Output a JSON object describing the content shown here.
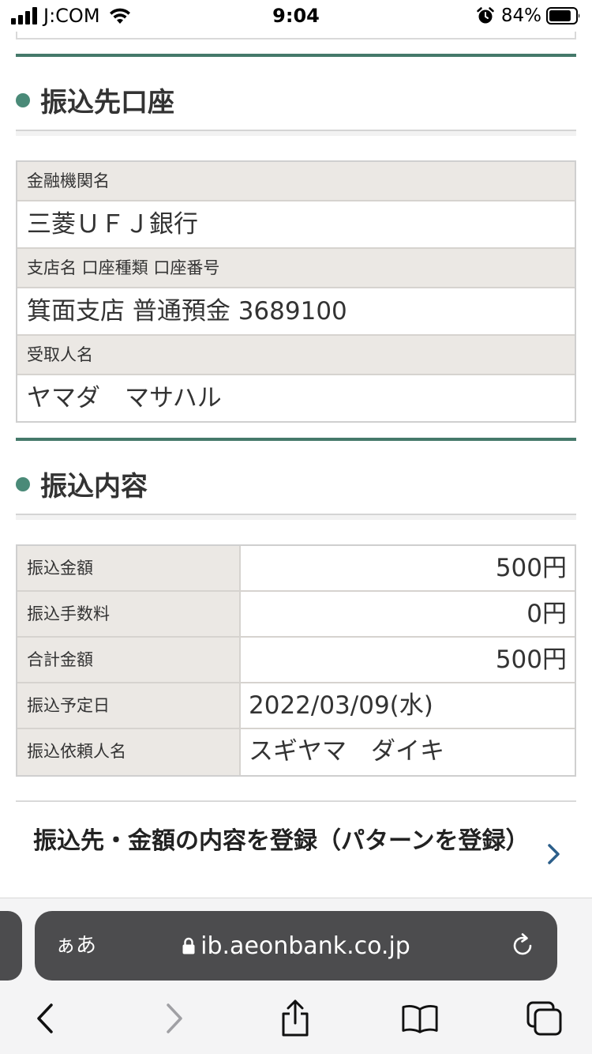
{
  "status_bar": {
    "carrier": "J:COM",
    "time": "9:04",
    "battery_percent": "84%",
    "battery_level": 0.84,
    "icons": [
      "signal-icon",
      "wifi-icon",
      "alarm-icon",
      "battery-icon"
    ]
  },
  "payee_section": {
    "title": "振込先口座",
    "rows": [
      {
        "label": "金融機関名",
        "value": "三菱ＵＦＪ銀行"
      },
      {
        "label": "支店名 口座種類 口座番号",
        "value": "箕面支店 普通預金 3689100"
      },
      {
        "label": "受取人名",
        "value": "ヤマダ　マサハル"
      }
    ]
  },
  "transfer_section": {
    "title": "振込内容",
    "rows": [
      {
        "label": "振込金額",
        "value": "500円"
      },
      {
        "label": "振込手数料",
        "value": "0円"
      },
      {
        "label": "合計金額",
        "value": "500円"
      },
      {
        "label": "振込予定日",
        "value": "2022/03/09(水)"
      },
      {
        "label": "振込依頼人名",
        "value": "スギヤマ　ダイキ"
      }
    ]
  },
  "register_link": {
    "label": "振込先・金額の内容を登録（パターンを登録）",
    "icon": "chevron-right-icon"
  },
  "browser": {
    "text_size_button": "ぁあ",
    "url": "ib.aeonbank.co.jp",
    "icons": [
      "lock-icon",
      "reload-icon",
      "back-icon",
      "forward-icon",
      "share-icon",
      "bookmarks-icon",
      "tabs-icon"
    ]
  },
  "colors": {
    "accent_green": "#45796a",
    "section_dot": "#4a8a78",
    "label_bg": "#ebe8e4",
    "chevron_blue": "#2c5f8a",
    "safari_bar": "#4c4c4e"
  }
}
